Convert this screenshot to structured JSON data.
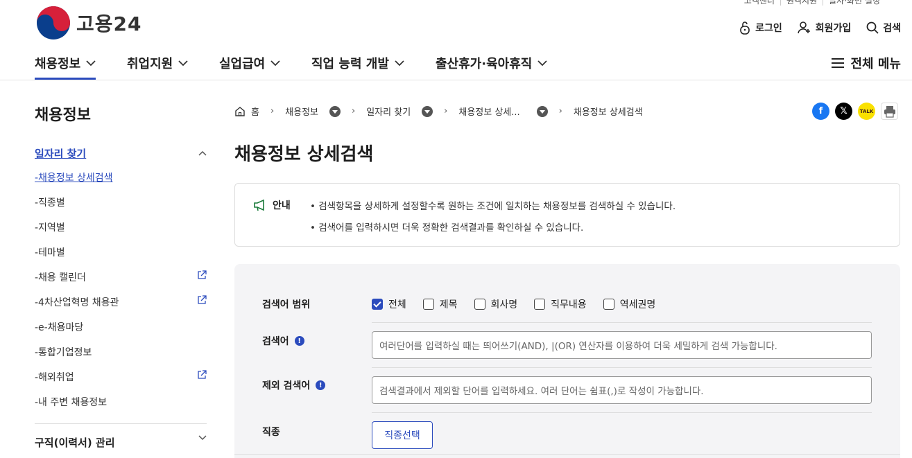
{
  "utility": [
    "고객센터",
    "원격지원",
    "글자·화면 설정"
  ],
  "logo": {
    "text": "고용24"
  },
  "top_actions": {
    "login": "로그인",
    "signup": "회원가입",
    "search": "검색"
  },
  "gnb": {
    "items": [
      "채용정보",
      "취업지원",
      "실업급여",
      "직업 능력 개발",
      "출산휴가·육아휴직"
    ],
    "all_menu": "전체 메뉴"
  },
  "sidebar": {
    "title": "채용정보",
    "group": "일자리 찾기",
    "items": [
      {
        "label": "-채용정보 상세검색",
        "external": false
      },
      {
        "label": "-직종별",
        "external": false
      },
      {
        "label": "-지역별",
        "external": false
      },
      {
        "label": "-테마별",
        "external": false
      },
      {
        "label": "-채용 캘린더",
        "external": true
      },
      {
        "label": "-4차산업혁명 채용관",
        "external": true
      },
      {
        "label": "-e-채용마당",
        "external": false
      },
      {
        "label": "-통합기업정보",
        "external": false
      },
      {
        "label": "-해외취업",
        "external": true
      },
      {
        "label": "-내 주변 채용정보",
        "external": false
      }
    ],
    "group2": "구직(이력서) 관리"
  },
  "breadcrumb": {
    "home": "홈",
    "c1": "채용정보",
    "c2": "일자리 찾기",
    "c3": "채용정보 상세...",
    "c4": "채용정보 상세검색"
  },
  "page_title": "채용정보 상세검색",
  "notice": {
    "label": "안내",
    "lines": [
      "• 검색항목을 상세하게 설정할수록 원하는 조건에 일치하는 채용정보를 검색하실 수 있습니다.",
      "• 검색어를 입력하시면 더욱 정확한 검색결과를 확인하실 수 있습니다."
    ]
  },
  "form": {
    "scope_label": "검색어 범위",
    "scope_options": [
      "전체",
      "제목",
      "회사명",
      "직무내용",
      "역세권명"
    ],
    "keyword_label": "검색어",
    "keyword_placeholder": "여러단어를 입력하실 때는 띄어쓰기(AND), |(OR) 연산자를 이용하여 더욱 세밀하게 검색 가능합니다.",
    "exclude_label": "제외 검색어",
    "exclude_placeholder": "검색결과에서 제외할 단어를 입력하세요. 여러 단어는 쉼표(,)로 작성이 가능합니다.",
    "job_label": "직종",
    "job_button": "직종선택"
  },
  "colors": {
    "accent": "#2b4bbd",
    "facebook": "#1877f2",
    "x": "#000000",
    "kakao": "#fae100"
  }
}
